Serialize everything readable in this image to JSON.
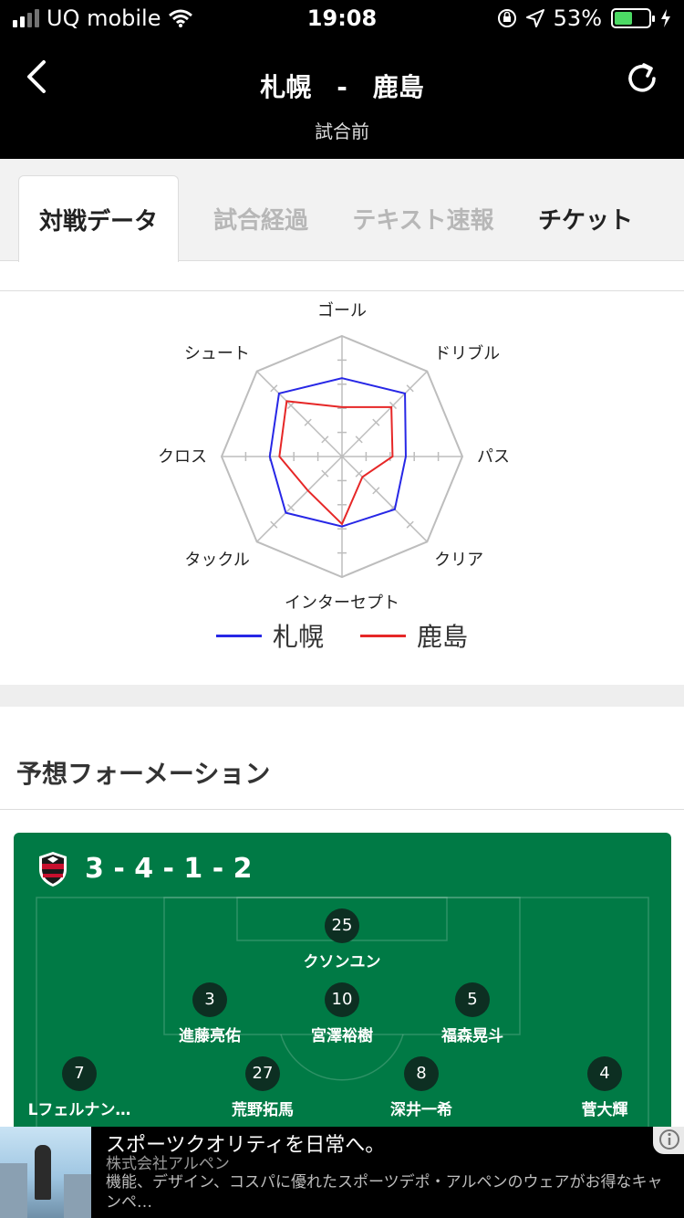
{
  "status": {
    "carrier": "UQ mobile",
    "time": "19:08",
    "battery": "53%",
    "battery_level": 0.53
  },
  "header": {
    "title": "札幌　-　鹿島",
    "subtitle": "試合前"
  },
  "tabs": [
    {
      "label": "対戦データ",
      "state": "active"
    },
    {
      "label": "試合経過",
      "state": "disabled"
    },
    {
      "label": "テキスト速報",
      "state": "disabled"
    },
    {
      "label": "チケット",
      "state": "enabled"
    }
  ],
  "radar": {
    "axes": [
      "ゴール",
      "ドリブル",
      "パス",
      "クリア",
      "インターセプト",
      "タックル",
      "クロス",
      "シュート"
    ],
    "max": 5,
    "series": [
      {
        "name": "札幌",
        "color": "#2727e6",
        "values": [
          3.25,
          3.7,
          2.65,
          3.1,
          2.9,
          3.3,
          3.0,
          3.7
        ]
      },
      {
        "name": "鹿島",
        "color": "#e62727",
        "values": [
          2.05,
          2.9,
          2.1,
          1.2,
          2.8,
          2.0,
          2.6,
          3.25
        ]
      }
    ]
  },
  "section": {
    "formation_title": "予想フォーメーション"
  },
  "formation": {
    "team_color_primary": "#c8102e",
    "pitch_color": "#007a45",
    "system": "3 - 4 - 1 - 2",
    "players": [
      {
        "number": "25",
        "name": "クソンユン"
      },
      {
        "number": "3",
        "name": "進藤亮佑"
      },
      {
        "number": "10",
        "name": "宮澤裕樹"
      },
      {
        "number": "5",
        "name": "福森晃斗"
      },
      {
        "number": "7",
        "name": "Lフェルナン…"
      },
      {
        "number": "27",
        "name": "荒野拓馬"
      },
      {
        "number": "8",
        "name": "深井一希"
      },
      {
        "number": "4",
        "name": "菅大輝"
      }
    ]
  },
  "ad": {
    "headline": "スポーツクオリティを日常へ。",
    "advertiser": "株式会社アルペン",
    "body": "機能、デザイン、コスパに優れたスポーツデポ・アルペンのウェアがお得なキャンペ…"
  }
}
